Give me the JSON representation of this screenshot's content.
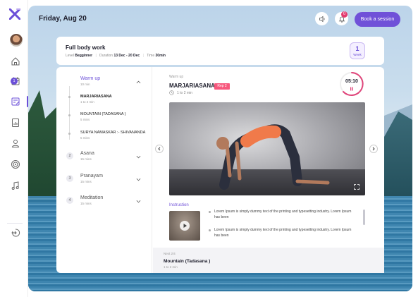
{
  "colors": {
    "accent": "#6b4fd8",
    "badge": "#f7587d",
    "notification": "#e33b6f"
  },
  "header": {
    "date": "Friday, Aug 20",
    "notification_count": "0",
    "book_button": "Book a session"
  },
  "sidebar": {
    "items": [
      {
        "icon": "home-icon"
      },
      {
        "icon": "calendar-icon"
      },
      {
        "icon": "edit-list-icon",
        "active": true
      },
      {
        "icon": "report-icon"
      },
      {
        "icon": "user-icon"
      },
      {
        "icon": "target-icon"
      },
      {
        "icon": "music-icon"
      }
    ],
    "bottom": {
      "icon": "logout-icon"
    }
  },
  "program": {
    "title": "Full body work",
    "level_label": "Level",
    "level_value": "Begginner",
    "duration_label": "Duration",
    "duration_value": "13 Dec - 20 Dec",
    "time_label": "Time",
    "time_value": "30min",
    "week_number": "1",
    "week_label": "Week"
  },
  "steps": [
    {
      "num": "1",
      "title": "Warm up",
      "duration": "10 min",
      "active": true
    },
    {
      "num": "2",
      "title": "Asana",
      "duration": "15 mins"
    },
    {
      "num": "3",
      "title": "Pranayam",
      "duration": "15 mins"
    },
    {
      "num": "4",
      "title": "Meditation",
      "duration": "15 mins"
    }
  ],
  "warmup_items": [
    {
      "title": "MARJARIASANA",
      "time": "1 to 2 min"
    },
    {
      "title": "MOUNTAIN (TADASANA )",
      "time": "5 mins"
    },
    {
      "title": "SURYA NAMASKAR :- SHIVANANDA",
      "time": "5 mins"
    }
  ],
  "current": {
    "section": "Warm up",
    "pose": "MARJARIASANA",
    "rep": "Rep 2",
    "time": "1 to 2 min",
    "timer": "05:10"
  },
  "instruction": {
    "title": "Instruction",
    "items": [
      "Lorem Ipsum is simply dummy text of the printing and typesetting industry. Lorem Ipsum has been",
      "Lorem Ipsum is simply dummy text of the printing and typesetting industry. Lorem Ipsum has been"
    ]
  },
  "next": {
    "label": "Next 2/4",
    "title": "Mountain (Tadasana )",
    "time": "1 to 2 min"
  }
}
